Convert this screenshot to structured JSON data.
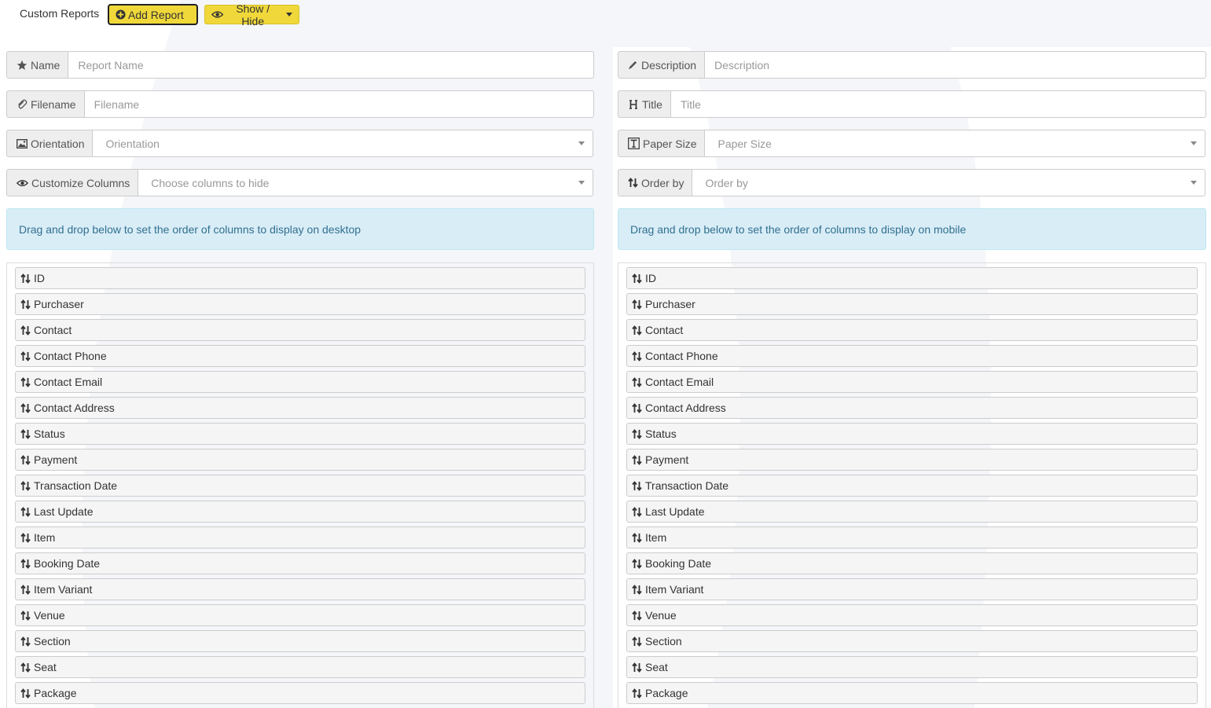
{
  "header": {
    "title": "Custom Reports",
    "add_report_label": "Add Report",
    "show_hide_label": "Show / Hide"
  },
  "form": {
    "name": {
      "label": "Name",
      "placeholder": "Report Name",
      "icon": "star-icon"
    },
    "description": {
      "label": "Description",
      "placeholder": "Description",
      "icon": "pencil-icon"
    },
    "filename": {
      "label": "Filename",
      "placeholder": "Filename",
      "icon": "paperclip-icon"
    },
    "title": {
      "label": "Title",
      "placeholder": "Title",
      "icon": "header-icon"
    },
    "orientation": {
      "label": "Orientation",
      "placeholder": "Orientation",
      "icon": "picture-icon"
    },
    "paper_size": {
      "label": "Paper Size",
      "placeholder": "Paper Size",
      "icon": "text-size-icon"
    },
    "customize_columns": {
      "label": "Customize Columns",
      "placeholder": "Choose columns to hide",
      "icon": "eye-icon"
    },
    "order_by": {
      "label": "Order by",
      "placeholder": "Order by",
      "icon": "sort-icon"
    }
  },
  "desktop": {
    "info": "Drag and drop below to set the order of columns to display on desktop",
    "columns": [
      "ID",
      "Purchaser",
      "Contact",
      "Contact Phone",
      "Contact Email",
      "Contact Address",
      "Status",
      "Payment",
      "Transaction Date",
      "Last Update",
      "Item",
      "Booking Date",
      "Item Variant",
      "Venue",
      "Section",
      "Seat",
      "Package"
    ]
  },
  "mobile": {
    "info": "Drag and drop below to set the order of columns to display on mobile",
    "columns": [
      "ID",
      "Purchaser",
      "Contact",
      "Contact Phone",
      "Contact Email",
      "Contact Address",
      "Status",
      "Payment",
      "Transaction Date",
      "Last Update",
      "Item",
      "Booking Date",
      "Item Variant",
      "Venue",
      "Section",
      "Seat",
      "Package"
    ]
  },
  "colors": {
    "button_yellow": "#f0d83a",
    "info_bg": "#d9edf7",
    "info_text": "#31708f",
    "addon_bg": "#eeeeee",
    "list_item_bg": "#f5f5f5"
  }
}
